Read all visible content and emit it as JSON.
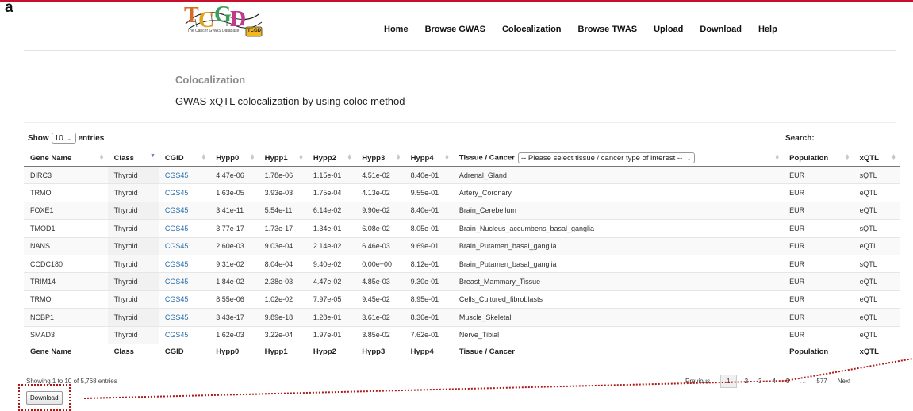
{
  "panel_label": "a",
  "logo": {
    "letters": [
      "T",
      "C",
      "G",
      "D"
    ],
    "sub": "The Cancer GWAS Database",
    "badge": "TCGD"
  },
  "nav": [
    "Home",
    "Browse GWAS",
    "Colocalization",
    "Browse TWAS",
    "Upload",
    "Download",
    "Help"
  ],
  "section": {
    "title": "Colocalization",
    "description": "GWAS-xQTL colocalization by using coloc method"
  },
  "length": {
    "prefix": "Show",
    "value": "10",
    "suffix": "entries"
  },
  "search": {
    "label": "Search:",
    "value": ""
  },
  "table": {
    "headers": [
      "Gene Name",
      "Class",
      "CGID",
      "Hypp0",
      "Hypp1",
      "Hypp2",
      "Hypp3",
      "Hypp4",
      "Tissue / Cancer",
      "Population",
      "xQTL"
    ],
    "tissue_filter": "-- Please select tissue / cancer type of interest --",
    "rows": [
      [
        "DIRC3",
        "Thyroid",
        "CGS45",
        "4.47e-06",
        "1.78e-06",
        "1.15e-01",
        "4.51e-02",
        "8.40e-01",
        "Adrenal_Gland",
        "EUR",
        "sQTL"
      ],
      [
        "TRMO",
        "Thyroid",
        "CGS45",
        "1.63e-05",
        "3.93e-03",
        "1.75e-04",
        "4.13e-02",
        "9.55e-01",
        "Artery_Coronary",
        "EUR",
        "eQTL"
      ],
      [
        "FOXE1",
        "Thyroid",
        "CGS45",
        "3.41e-11",
        "5.54e-11",
        "6.14e-02",
        "9.90e-02",
        "8.40e-01",
        "Brain_Cerebellum",
        "EUR",
        "eQTL"
      ],
      [
        "TMOD1",
        "Thyroid",
        "CGS45",
        "3.77e-17",
        "1.73e-17",
        "1.34e-01",
        "6.08e-02",
        "8.05e-01",
        "Brain_Nucleus_accumbens_basal_ganglia",
        "EUR",
        "sQTL"
      ],
      [
        "NANS",
        "Thyroid",
        "CGS45",
        "2.60e-03",
        "9.03e-04",
        "2.14e-02",
        "6.46e-03",
        "9.69e-01",
        "Brain_Putamen_basal_ganglia",
        "EUR",
        "eQTL"
      ],
      [
        "CCDC180",
        "Thyroid",
        "CGS45",
        "9.31e-02",
        "8.04e-04",
        "9.40e-02",
        "0.00e+00",
        "8.12e-01",
        "Brain_Putamen_basal_ganglia",
        "EUR",
        "sQTL"
      ],
      [
        "TRIM14",
        "Thyroid",
        "CGS45",
        "1.84e-02",
        "2.38e-03",
        "4.47e-02",
        "4.85e-03",
        "9.30e-01",
        "Breast_Mammary_Tissue",
        "EUR",
        "eQTL"
      ],
      [
        "TRMO",
        "Thyroid",
        "CGS45",
        "8.55e-06",
        "1.02e-02",
        "7.97e-05",
        "9.45e-02",
        "8.95e-01",
        "Cells_Cultured_fibroblasts",
        "EUR",
        "eQTL"
      ],
      [
        "NCBP1",
        "Thyroid",
        "CGS45",
        "3.43e-17",
        "9.89e-18",
        "1.28e-01",
        "3.61e-02",
        "8.36e-01",
        "Muscle_Skeletal",
        "EUR",
        "eQTL"
      ],
      [
        "SMAD3",
        "Thyroid",
        "CGS45",
        "1.62e-03",
        "3.22e-04",
        "1.97e-01",
        "3.85e-02",
        "7.62e-01",
        "Nerve_Tibial",
        "EUR",
        "eQTL"
      ]
    ]
  },
  "info": "Showing 1 to 10 of 5,768 entries",
  "pagination": {
    "previous": "Previous",
    "pages": [
      "1",
      "2",
      "3",
      "4",
      "5"
    ],
    "ellipsis": "…",
    "last": "577",
    "next": "Next",
    "current": "1"
  },
  "download_label": "Download",
  "colors": {
    "accent_line": "#c8102e",
    "link": "#2a6fad",
    "annotation": "#b01818"
  }
}
